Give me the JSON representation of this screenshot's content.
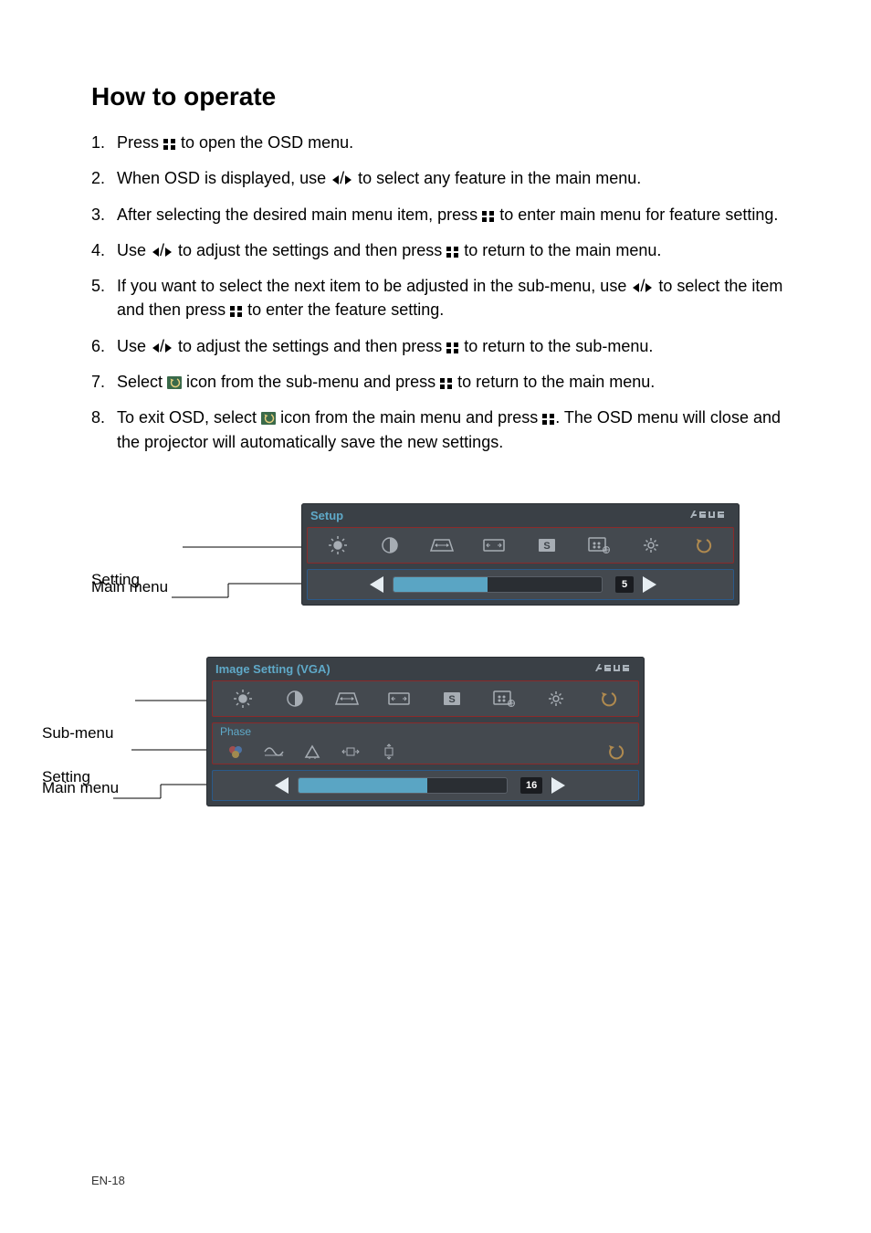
{
  "title": "How to operate",
  "steps": [
    {
      "n": "1.",
      "parts": [
        "Press ",
        {
          "icon": "menu"
        },
        " to open the OSD menu."
      ]
    },
    {
      "n": "2.",
      "parts": [
        "When OSD is displayed, use ",
        {
          "icon": "left"
        },
        "/",
        {
          "icon": "right"
        },
        " to select any feature in the main menu."
      ]
    },
    {
      "n": "3.",
      "parts": [
        "After selecting the desired main menu item, press ",
        {
          "icon": "menu"
        },
        " to enter main menu for feature setting."
      ]
    },
    {
      "n": "4.",
      "parts": [
        "Use ",
        {
          "icon": "left"
        },
        "/",
        {
          "icon": "right"
        },
        " to adjust the settings and then press ",
        {
          "icon": "menu"
        },
        " to return to the main menu."
      ]
    },
    {
      "n": "5.",
      "parts": [
        "If you want to select the next item to be adjusted in the sub-menu, use ",
        {
          "icon": "left"
        },
        "/",
        {
          "icon": "right"
        },
        " to select the item and then press ",
        {
          "icon": "menu"
        },
        "  to enter the feature setting."
      ]
    },
    {
      "n": "6.",
      "parts": [
        "Use ",
        {
          "icon": "left"
        },
        "/",
        {
          "icon": "right"
        },
        " to adjust the settings and then press ",
        {
          "icon": "menu"
        },
        " to return to the sub-menu."
      ]
    },
    {
      "n": "7.",
      "parts": [
        "Select ",
        {
          "icon": "back-box"
        },
        " icon from the sub-menu and press ",
        {
          "icon": "menu"
        },
        " to return to the main menu."
      ]
    },
    {
      "n": "8.",
      "parts": [
        "To exit OSD, select ",
        {
          "icon": "back-box"
        },
        " icon from the main menu and press ",
        {
          "icon": "menu"
        },
        ". The OSD menu will close and the projector will automatically save the new settings."
      ]
    }
  ],
  "labels": {
    "main_menu": "Main menu",
    "setting": "Setting",
    "sub_menu": "Sub-menu"
  },
  "osd1": {
    "title": "Setup",
    "slider_value": "5",
    "slider_percent": 45
  },
  "osd2": {
    "title": "Image Setting (VGA)",
    "sub_title": "Phase",
    "slider_value": "16",
    "slider_percent": 62
  },
  "footer": "EN-18"
}
